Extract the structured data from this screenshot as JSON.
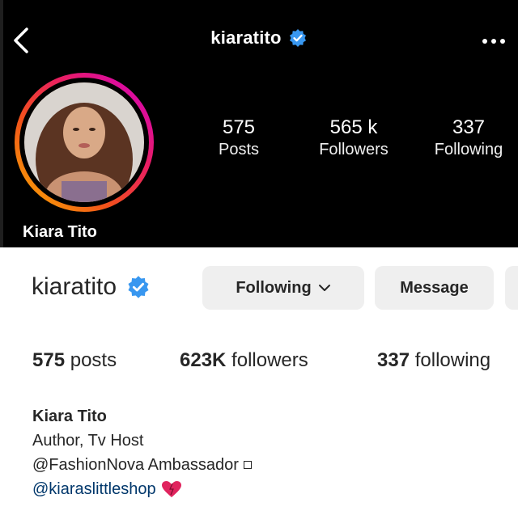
{
  "mobile": {
    "title": "kiaratito",
    "stats": [
      {
        "value": "575",
        "label": "Posts"
      },
      {
        "value": "565 k",
        "label": "Followers"
      },
      {
        "value": "337",
        "label": "Following"
      }
    ],
    "display_name": "Kiara Tito",
    "icons": {
      "back": "back-arrow-icon",
      "verified": "verified-badge-icon",
      "more": "more-options-icon"
    }
  },
  "desktop": {
    "username": "kiaratito",
    "following_button": "Following",
    "message_button": "Message",
    "stats": {
      "posts_num": "575",
      "posts_lbl": "posts",
      "followers_num": "623K",
      "followers_lbl": "followers",
      "following_num": "337",
      "following_lbl": "following"
    }
  },
  "bio": {
    "name": "Kiara Tito",
    "line1": "Author, Tv Host",
    "line2": "@FashionNova Ambassador",
    "line3": "@kiaraslittleshop"
  },
  "colors": {
    "verified": "#3897f0",
    "link": "#00376b",
    "button_bg": "#efefef",
    "heart": "#e0245e"
  }
}
